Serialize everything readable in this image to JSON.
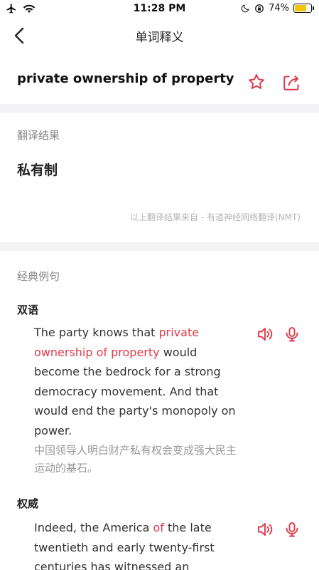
{
  "status_bar": {
    "time": "11:28 PM",
    "battery_percent": "74%",
    "battery_level": 0.74,
    "icons": [
      "airplane-icon",
      "wifi-icon",
      "moon-icon",
      "orientation-lock-icon",
      "battery-icon"
    ]
  },
  "nav": {
    "title": "单词释义"
  },
  "word": {
    "text": "private ownership of property"
  },
  "translation": {
    "label": "翻译结果",
    "result": "私有制",
    "source": "以上翻译结果来自 - 有道神经网络翻译(NMT)"
  },
  "examples": {
    "label": "经典例句",
    "groups": [
      {
        "label": "双语",
        "items": [
          {
            "en_before": "The party knows that ",
            "en_highlight": "private ownership of property",
            "en_after": " would become the bedrock for a strong democracy movement. And that would end the party's monopoly on power.",
            "cn": "中国领导人明白财产私有权会变成强大民主运动的基石。"
          }
        ]
      },
      {
        "label": "权威",
        "items": [
          {
            "en_before": "Indeed, the America ",
            "en_highlight": "of",
            "en_after": " the late twentieth and early twenty-first centuries has witnessed an",
            "cn": ""
          }
        ]
      }
    ]
  },
  "colors": {
    "accent": "#e03a4a",
    "muted": "#888888",
    "band": "#f3f3f5"
  }
}
